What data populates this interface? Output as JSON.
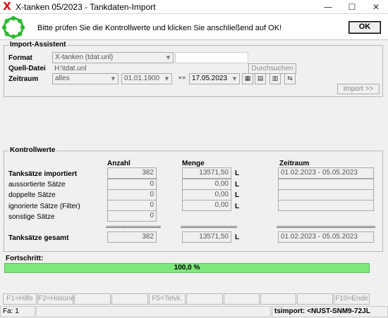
{
  "window": {
    "title": "X-tanken 05/2023 - Tankdaten-Import",
    "minimize": "—",
    "maximize": "☐",
    "close": "✕"
  },
  "header": {
    "message": "Bitte prüfen Sie die Kontrollwerte und klicken Sie anschließend auf OK!",
    "ok_label": "OK"
  },
  "assistant": {
    "title": "Import-Assistent",
    "format_label": "Format",
    "format_value": "X-tanken (tdat.unl)",
    "format_extra": "",
    "source_label": "Quell-Datei",
    "source_value": "H:\\tdat.unl",
    "browse_label": "Durchsuchen",
    "period_label": "Zeitraum",
    "period_value": "alles",
    "date_from": "01.01.1900",
    "date_to": "17.05.2023",
    "range_icon": "»»",
    "import_label": "Import >>"
  },
  "control": {
    "title": "Kontrollwerte",
    "headers": {
      "count": "Anzahl",
      "quantity": "Menge",
      "period": "Zeitraum"
    },
    "unit": "L",
    "rows": [
      {
        "label": "Tanksätze importiert",
        "count": "382",
        "quantity": "13571,50",
        "period": "01.02.2023 - 05.05.2023",
        "bold": true
      },
      {
        "label": "aussortierte Sätze",
        "count": "0",
        "quantity": "0,00",
        "period": ""
      },
      {
        "label": "doppelte Sätze",
        "count": "0",
        "quantity": "0,00",
        "period": ""
      },
      {
        "label": "ignorierte Sätze (Filter)",
        "count": "0",
        "quantity": "0,00",
        "period": ""
      },
      {
        "label": "sonstige Sätze",
        "count": "0"
      }
    ],
    "separator": "====================================",
    "total": {
      "label": "Tanksätze gesamt",
      "count": "382",
      "quantity": "13571,50",
      "period": "01.02.2023 - 05.05.2023"
    }
  },
  "progress": {
    "label": "Fortschritt:",
    "value": 1.0,
    "text": "100,0 %"
  },
  "fkeys": [
    "F1=Hilfe",
    "F2=Historie",
    "",
    "",
    "F5=Telvk.",
    "",
    "",
    "",
    "",
    "F10=Ende"
  ],
  "statusbar": {
    "left": "Fa: 1",
    "right": "tsimport: <NUST-SNM9-72JL"
  },
  "colors": {
    "progress": "#7de87d",
    "brand_icon": "#d81010",
    "ring": "#2dbb2d"
  }
}
